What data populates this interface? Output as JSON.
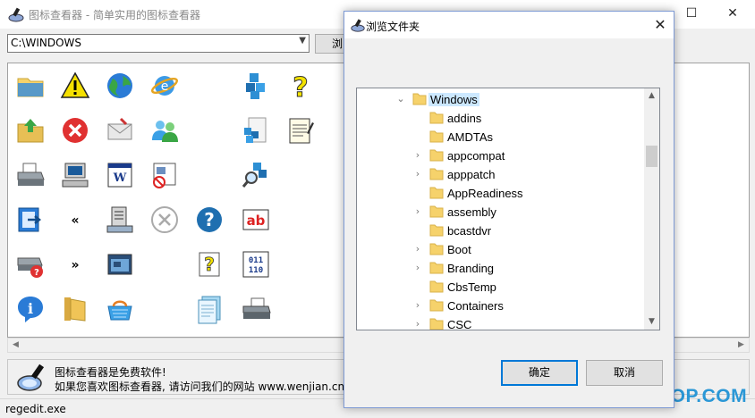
{
  "main_window": {
    "title": "图标查看器 - 简单实用的图标查看器",
    "path_value": "C:\\WINDOWS",
    "browse_label": "浏",
    "info_line1": "图标查看器是免费软件!",
    "info_line2": "如果您喜欢图标查看器, 请访问我们的网站 www.wenjian.cn !",
    "status_text": "regedit.exe"
  },
  "icons": [
    {
      "name": "folder-icon"
    },
    {
      "name": "warning-icon"
    },
    {
      "name": "globe-icon"
    },
    {
      "name": "internet-icon"
    },
    {
      "name": "network-cubes-icon"
    },
    {
      "name": "help-question-icon"
    },
    {
      "name": "folder-up-icon"
    },
    {
      "name": "error-x-icon"
    },
    {
      "name": "mail-icon"
    },
    {
      "name": "users-icon"
    },
    {
      "name": "cubes-file-icon"
    },
    {
      "name": "notepad-icon"
    },
    {
      "name": "printer-icon"
    },
    {
      "name": "computer-icon"
    },
    {
      "name": "word-doc-icon"
    },
    {
      "name": "blocked-doc-icon"
    },
    {
      "name": "search-cubes-icon"
    },
    {
      "name": "exit-arrow-icon"
    },
    {
      "name": "double-left-icon"
    },
    {
      "name": "server-icon"
    },
    {
      "name": "cancel-circle-icon"
    },
    {
      "name": "help-circle-icon"
    },
    {
      "name": "ab-text-icon"
    },
    {
      "name": "printer-error-icon"
    },
    {
      "name": "double-right-icon"
    },
    {
      "name": "window-icon"
    },
    {
      "name": "help-doc-icon"
    },
    {
      "name": "binary-file-icon"
    },
    {
      "name": "info-icon"
    },
    {
      "name": "folder-open-icon"
    },
    {
      "name": "basket-icon"
    },
    {
      "name": "notebook-icon"
    },
    {
      "name": "scanner-icon"
    }
  ],
  "dialog": {
    "title": "浏览文件夹",
    "ok_label": "确定",
    "cancel_label": "取消",
    "folders": [
      {
        "label": "Windows",
        "expanded": true,
        "selected": true
      },
      {
        "label": "addins",
        "has_children": false
      },
      {
        "label": "AMDTAs",
        "has_children": false
      },
      {
        "label": "appcompat",
        "has_children": true
      },
      {
        "label": "apppatch",
        "has_children": true
      },
      {
        "label": "AppReadiness",
        "has_children": false
      },
      {
        "label": "assembly",
        "has_children": true
      },
      {
        "label": "bcastdvr",
        "has_children": false
      },
      {
        "label": "Boot",
        "has_children": true
      },
      {
        "label": "Branding",
        "has_children": true
      },
      {
        "label": "CbsTemp",
        "has_children": false
      },
      {
        "label": "Containers",
        "has_children": true
      },
      {
        "label": "CSC",
        "has_children": true
      }
    ]
  },
  "watermark": "ITMOP.COM",
  "colors": {
    "accent": "#0078d7",
    "selection": "#cce8ff",
    "folder": "#f6d26b",
    "watermark": "#2a97d6"
  }
}
